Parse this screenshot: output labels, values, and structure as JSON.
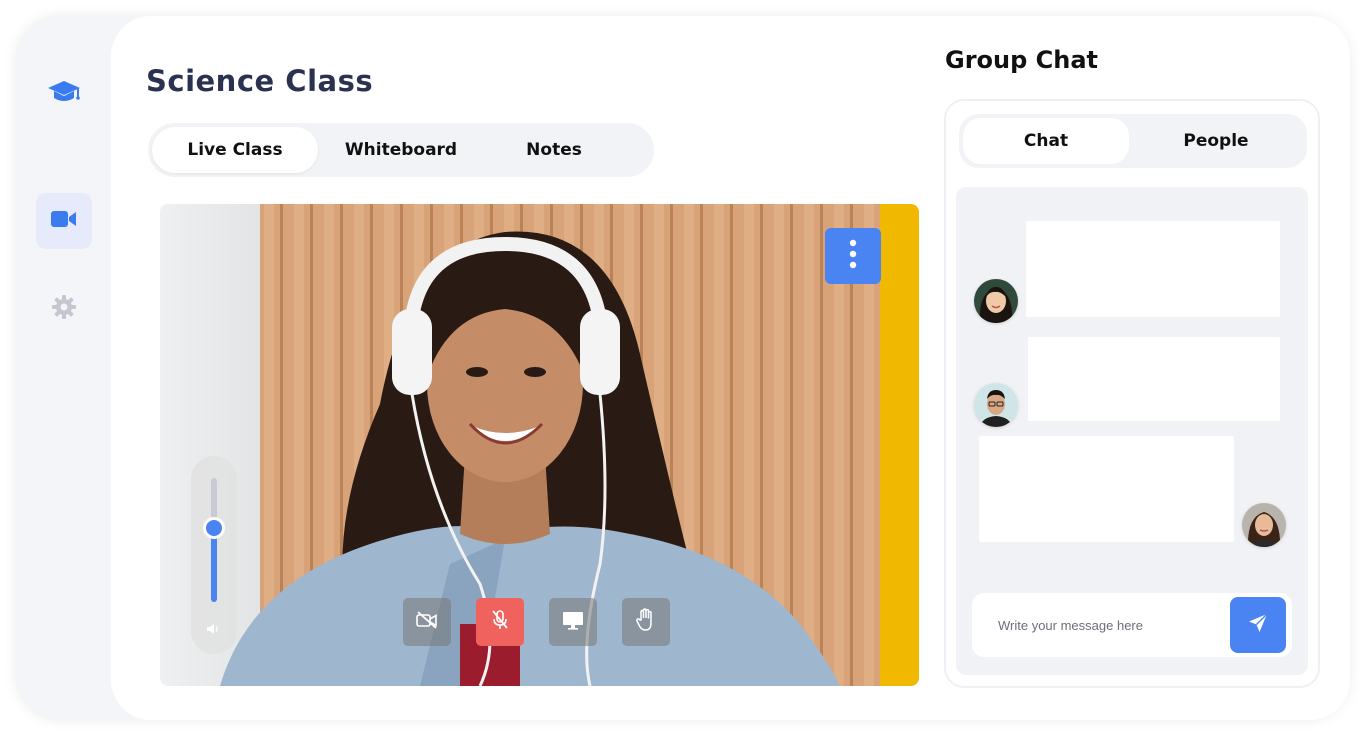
{
  "app": {
    "title": "Science Class",
    "accent_color": "#4a84f2"
  },
  "sidebar": {
    "items": [
      {
        "icon": "graduation-cap-icon",
        "active": false
      },
      {
        "icon": "video-camera-icon",
        "active": true
      },
      {
        "icon": "gear-icon",
        "active": false
      }
    ]
  },
  "tabs": [
    {
      "label": "Live Class",
      "active": true
    },
    {
      "label": "Whiteboard",
      "active": false
    },
    {
      "label": "Notes",
      "active": false
    }
  ],
  "video": {
    "more_icon": "vertical-dots-icon",
    "volume_level": 0.6,
    "controls": [
      {
        "icon": "camera-off-icon",
        "active": false
      },
      {
        "icon": "mic-off-icon",
        "active": true,
        "color": "#f0625d"
      },
      {
        "icon": "screen-share-icon",
        "active": false
      },
      {
        "icon": "raise-hand-icon",
        "active": false
      }
    ]
  },
  "chat": {
    "title": "Group Chat",
    "tabs": [
      {
        "label": "Chat",
        "active": true
      },
      {
        "label": "People",
        "active": false
      }
    ],
    "messages": [
      {
        "side": "left",
        "text": ""
      },
      {
        "side": "left",
        "text": ""
      },
      {
        "side": "right",
        "text": ""
      }
    ],
    "input": {
      "placeholder": "Write your message here",
      "value": ""
    },
    "send_icon": "send-arrow-icon"
  }
}
